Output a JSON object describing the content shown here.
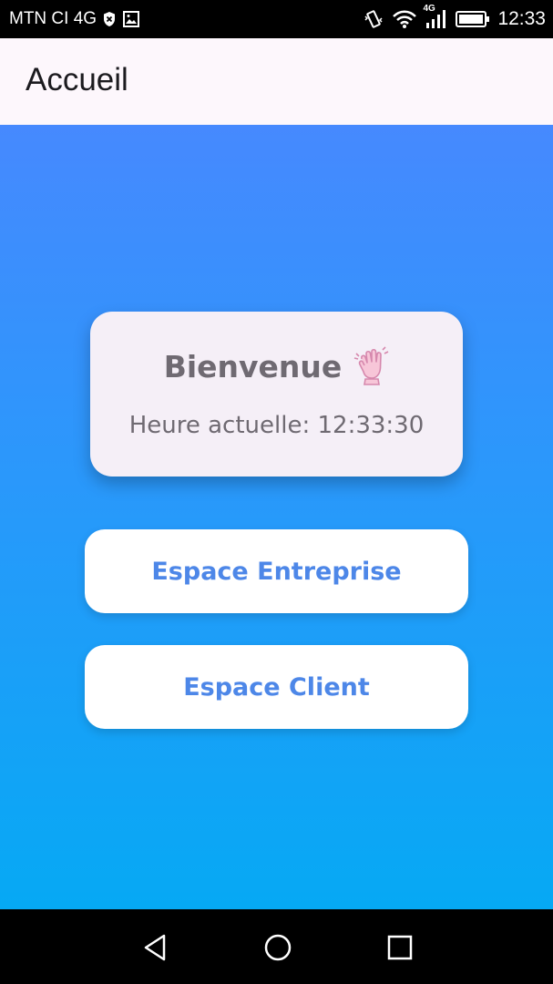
{
  "status_bar": {
    "carrier": "MTN CI 4G",
    "network_badge": "4G",
    "time": "12:33",
    "icons": [
      "shield-icon",
      "image-icon",
      "vibrate-icon",
      "wifi-icon",
      "signal-icon",
      "battery-icon"
    ]
  },
  "app_bar": {
    "title": "Accueil"
  },
  "welcome_card": {
    "title": "Bienvenue",
    "icon": "waving-hand-icon",
    "clock_label": "Heure actuelle: 12:33:30"
  },
  "buttons": {
    "entreprise_label": "Espace Entreprise",
    "client_label": "Espace Client"
  },
  "nav_bar": {
    "icons": [
      "back-icon",
      "home-icon",
      "recent-apps-icon"
    ]
  },
  "colors": {
    "gradient_top": "#4689fe",
    "gradient_bottom": "#06a9f4",
    "button_text": "#4d87e8",
    "card_background": "#f5eff7",
    "app_bar_background": "#fdf7fc"
  }
}
